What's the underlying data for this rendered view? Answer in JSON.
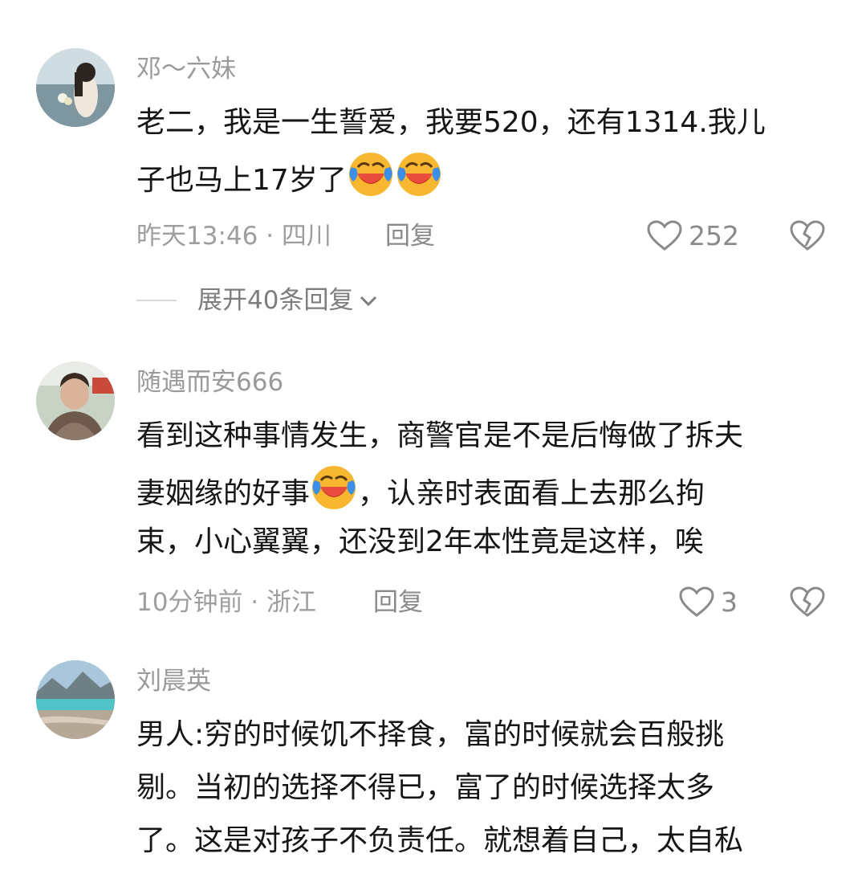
{
  "comments": [
    {
      "username": "邓～六妹",
      "lines": [
        "老二，我是一生誓爱，我要520，还有1314.我儿",
        "子也马上17岁了"
      ],
      "time_location": "昨天13:46 · 四川",
      "reply_label": "回复",
      "likes": "252"
    },
    {
      "username": "随遇而安666",
      "lines": [
        "看到这种事情发生，商警官是不是后悔做了拆夫",
        "妻姻缘的好事",
        "，认亲时表面看上去那么拘",
        "束，小心翼翼，还没到2年本性竟是这样，唉"
      ],
      "time_location": "10分钟前 · 浙江",
      "reply_label": "回复",
      "likes": "3"
    },
    {
      "username": "刘晨英",
      "lines": [
        "男人:穷的时候饥不择食，富的时候就会百般挑",
        "剔。当初的选择不得已，富了的时候选择太多",
        "了。这是对孩子不负责任。就想着自己，太自私"
      ]
    }
  ],
  "expand_replies": "展开40条回复",
  "icons": {
    "like": "heart-outline-icon",
    "dislike": "broken-heart-icon",
    "expand": "chevron-down-icon",
    "emoji": "laughing-crying-emoji"
  },
  "colors": {
    "username": "#9a9a9a",
    "body_text": "#161616",
    "meta": "#9e9e9e",
    "emoji_yellow": "#f7b731",
    "emoji_tear": "#3b8fe8"
  }
}
